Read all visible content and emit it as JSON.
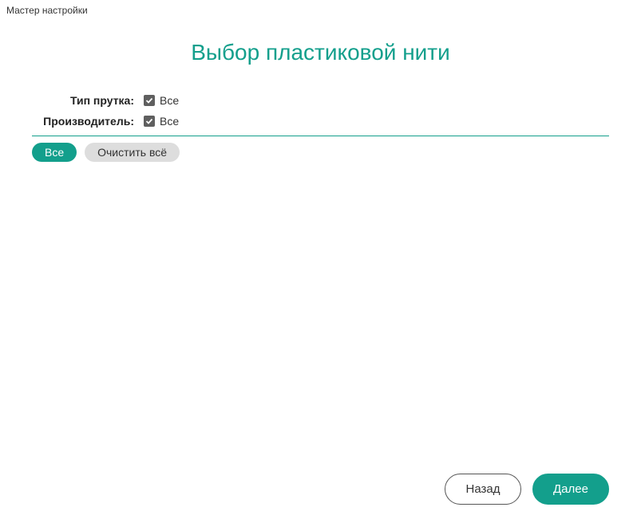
{
  "window": {
    "title": "Мастер настройки"
  },
  "heading": "Выбор пластиковой нити",
  "filters": {
    "filament_type": {
      "label": "Тип прутка:",
      "checkbox": "Все",
      "checked": true
    },
    "manufacturer": {
      "label": "Производитель:",
      "checkbox": "Все",
      "checked": true
    }
  },
  "buttons": {
    "select_all": "Все",
    "clear_all": "Очистить всё",
    "back": "Назад",
    "next": "Далее"
  },
  "colors": {
    "accent": "#139f8c"
  }
}
